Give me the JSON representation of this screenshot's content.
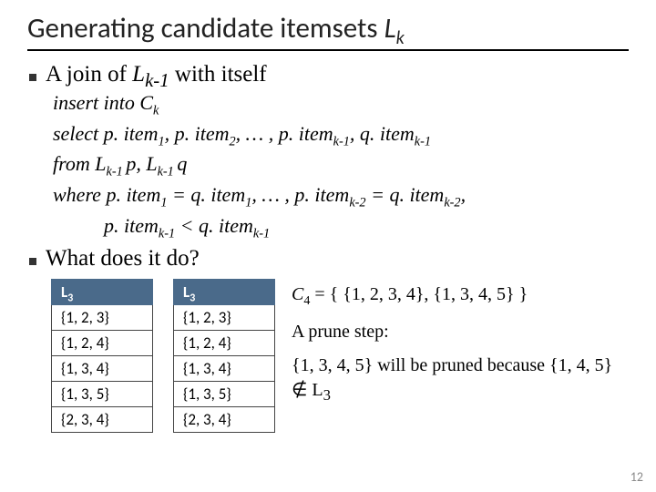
{
  "title": {
    "pre": "Generating candidate itemsets ",
    "sym": "L",
    "sub": "k"
  },
  "bullet1": {
    "pre": "A join of ",
    "sym": "L",
    "sub": "k-1",
    "post": " with itself"
  },
  "sql": {
    "l1": {
      "a": "insert into C",
      "sub": "k"
    },
    "l2": {
      "a": "select p. item",
      "s1": "1",
      "b": ", p. item",
      "s2": "2",
      "c": ", … , p. item",
      "s3": "k-1",
      "d": ", q. item",
      "s4": "k-1"
    },
    "l3": {
      "a": "from L",
      "s1": "k-1 ",
      "b": "p, L",
      "s2": "k-1 ",
      "c": "q"
    },
    "l4": {
      "a": "where p. item",
      "s1": "1",
      "b": " = q. item",
      "s2": "1",
      "c": ", … , p. item",
      "s3": "k-2",
      "d": " = q. item",
      "s4": "k-2",
      "e": ","
    },
    "l5": {
      "a": "p. item",
      "s1": "k-1",
      "b": " < q. item",
      "s2": "k-1"
    }
  },
  "bullet2": "What does it do?",
  "table_header": {
    "sym": "L",
    "sub": "3"
  },
  "table_rows": [
    "{1, 2, 3}",
    "{1, 2, 4}",
    "{1, 3, 4}",
    "{1, 3, 5}",
    "{2, 3, 4}"
  ],
  "right": {
    "c4": {
      "sym": "C",
      "sub": "4",
      "rest": " = { {1, 2, 3, 4}, {1, 3, 4, 5} }"
    },
    "prune": "A prune step:",
    "reason": {
      "a": "{1, 3, 4, 5} will be pruned because {1, 4, 5} ",
      "notin": "∉",
      "b": " L",
      "sub": "3"
    }
  },
  "pagenum": "12"
}
